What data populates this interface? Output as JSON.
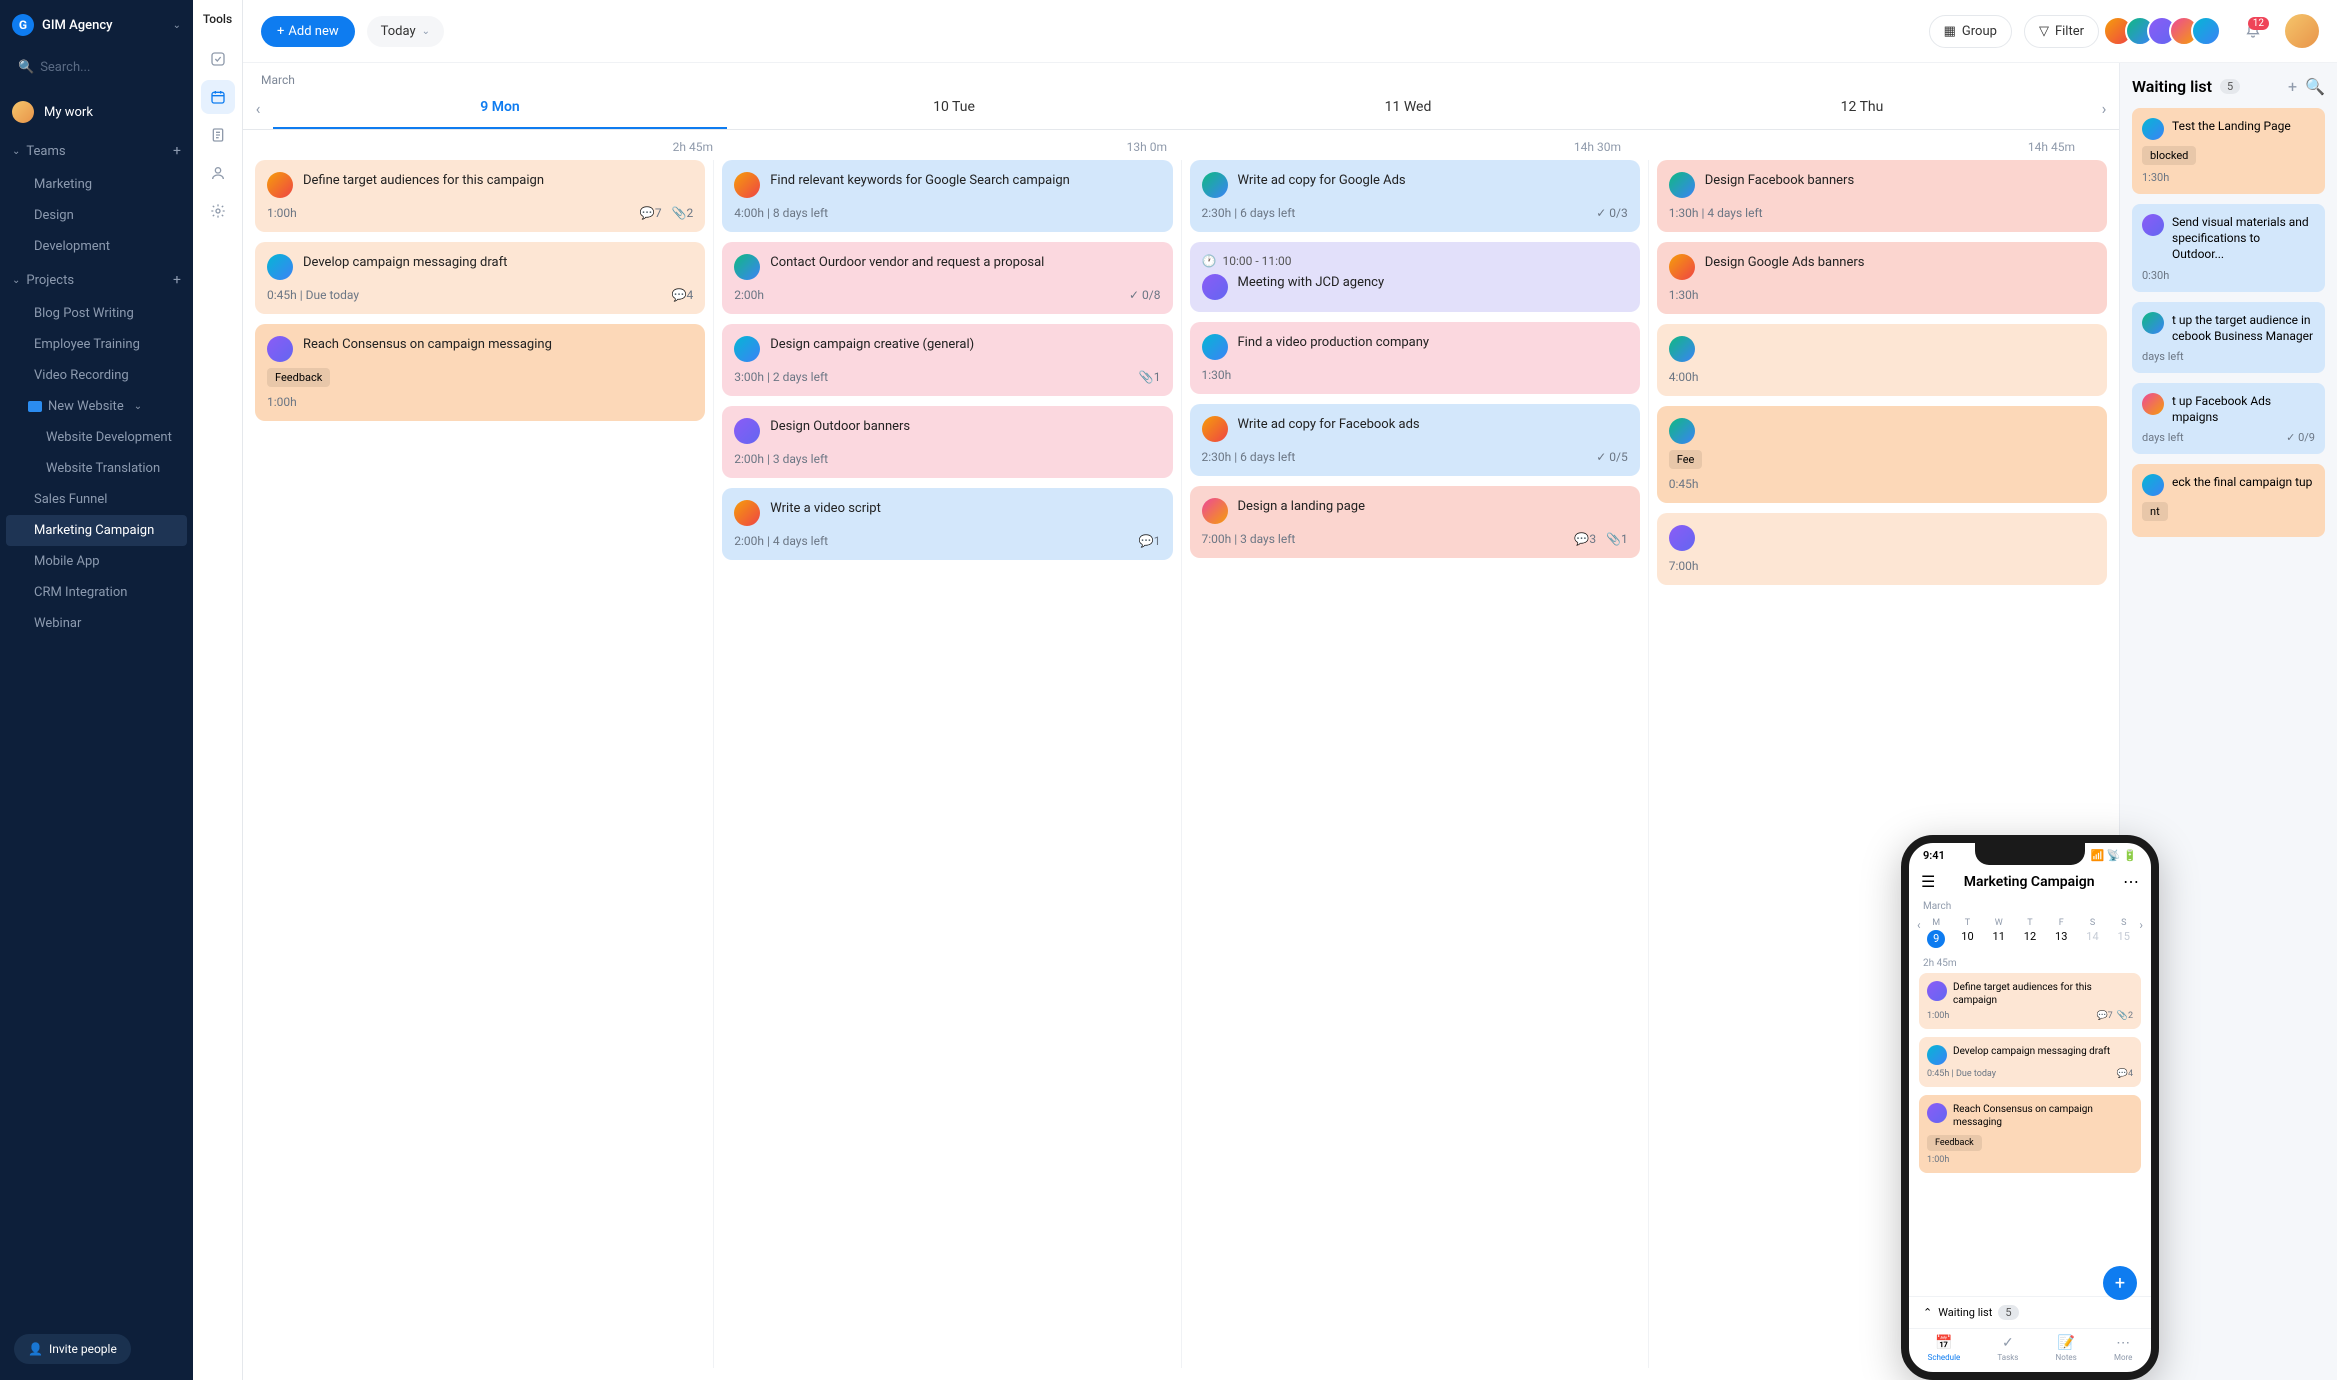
{
  "org": {
    "name": "GIM Agency",
    "letter": "G"
  },
  "search": {
    "placeholder": "Search..."
  },
  "mywork": "My work",
  "sections": {
    "teams": "Teams",
    "projects": "Projects"
  },
  "teams": [
    "Marketing",
    "Design",
    "Development"
  ],
  "projects": [
    "Blog Post Writing",
    "Employee Training",
    "Video Recording"
  ],
  "folder": {
    "name": "New Website",
    "items": [
      "Website Development",
      "Website Translation"
    ]
  },
  "projects2": [
    "Sales Funnel",
    "Marketing Campaign",
    "Mobile App",
    "CRM Integration",
    "Webinar"
  ],
  "activeProject": "Marketing Campaign",
  "invite": "Invite people",
  "toolRail": {
    "label": "Tools"
  },
  "topbar": {
    "addNew": "Add new",
    "today": "Today",
    "group": "Group",
    "filter": "Filter",
    "notificationCount": "12"
  },
  "calendar": {
    "month": "March",
    "days": [
      {
        "label": "9 Mon",
        "hours": "2h 45m"
      },
      {
        "label": "10 Tue",
        "hours": "13h 0m"
      },
      {
        "label": "11 Wed",
        "hours": "14h 30m"
      },
      {
        "label": "12 Thu",
        "hours": "14h 45m"
      }
    ]
  },
  "columns": [
    [
      {
        "c": "c-peach",
        "title": "Define target audiences for this campaign",
        "time": "1:00h",
        "comments": "7",
        "attach": "2"
      },
      {
        "c": "c-peach",
        "title": "Develop campaign messaging draft",
        "time": "0:45h",
        "due": "Due today",
        "comments": "4"
      },
      {
        "c": "c-orange",
        "title": "Reach Consensus on campaign messaging",
        "tag": "Feedback",
        "time": "1:00h"
      }
    ],
    [
      {
        "c": "c-blue",
        "title": "Find relevant keywords for Google Search campaign",
        "time": "4:00h",
        "due": "8 days left"
      },
      {
        "c": "c-pink",
        "title": "Contact Ourdoor vendor and request a proposal",
        "time": "2:00h",
        "check": "0/8"
      },
      {
        "c": "c-pink",
        "title": "Design campaign creative (general)",
        "time": "3:00h",
        "due": "2 days left",
        "attach": "1"
      },
      {
        "c": "c-pink",
        "title": "Design Outdoor banners",
        "time": "2:00h",
        "due": "3 days left"
      },
      {
        "c": "c-blue",
        "title": "Write a video script",
        "time": "2:00h",
        "due": "4 days left",
        "comments": "1"
      }
    ],
    [
      {
        "c": "c-blue",
        "title": "Write ad copy for Google Ads",
        "time": "2:30h",
        "due": "6 days left",
        "check": "0/3"
      },
      {
        "c": "c-lav",
        "clock": "10:00 - 11:00",
        "title": "Meeting with JCD agency"
      },
      {
        "c": "c-pink",
        "title": "Find a video production company",
        "time": "1:30h"
      },
      {
        "c": "c-blue",
        "title": "Write ad copy for Facebook ads",
        "time": "2:30h",
        "due": "6 days left",
        "check": "0/5"
      },
      {
        "c": "c-red",
        "title": "Design a landing page",
        "time": "7:00h",
        "due": "3 days left",
        "comments": "3",
        "attach": "1"
      }
    ],
    [
      {
        "c": "c-red",
        "title": "Design Facebook banners",
        "time": "1:30h",
        "due": "4 days left"
      },
      {
        "c": "c-red",
        "title": "Design Google Ads banners",
        "time": "1:30h"
      },
      {
        "c": "c-peach",
        "title": "",
        "time": "4:00h"
      },
      {
        "c": "c-orange",
        "title": "",
        "tag": "Fee",
        "time": "0:45h"
      },
      {
        "c": "c-peach",
        "title": "",
        "time": "7:00h"
      }
    ]
  ],
  "waiting": {
    "title": "Waiting list",
    "count": "5",
    "items": [
      {
        "c": "c-orange",
        "title": "Test the Landing Page",
        "tag": "blocked",
        "time": "1:30h"
      },
      {
        "c": "c-blue",
        "title": "Send visual materials and specifications to Outdoor...",
        "time": "0:30h"
      },
      {
        "c": "c-blue",
        "title": "t up the target audience in cebook Business Manager",
        "due": "days left"
      },
      {
        "c": "c-blue",
        "title": "t up Facebook Ads mpaigns",
        "due": "days left",
        "check": "0/9"
      },
      {
        "c": "c-orange",
        "title": "eck the final campaign tup",
        "tag": "nt"
      }
    ]
  },
  "phone": {
    "time": "9:41",
    "title": "Marketing Campaign",
    "month": "March",
    "week": [
      {
        "wd": "M",
        "dn": "9",
        "active": true
      },
      {
        "wd": "T",
        "dn": "10"
      },
      {
        "wd": "W",
        "dn": "11"
      },
      {
        "wd": "T",
        "dn": "12"
      },
      {
        "wd": "F",
        "dn": "13"
      },
      {
        "wd": "S",
        "dn": "14",
        "dim": true
      },
      {
        "wd": "S",
        "dn": "15",
        "dim": true
      }
    ],
    "hours": "2h 45m",
    "cards": [
      {
        "c": "c-peach",
        "title": "Define target audiences for this campaign",
        "time": "1:00h",
        "comments": "7",
        "attach": "2"
      },
      {
        "c": "c-peach",
        "title": "Develop campaign messaging draft",
        "time": "0:45h",
        "due": "Due today",
        "comments": "4"
      },
      {
        "c": "c-orange",
        "title": "Reach Consensus on campaign messaging",
        "tag": "Feedback",
        "time": "1:00h"
      }
    ],
    "wait": {
      "label": "Waiting list",
      "count": "5"
    },
    "tabs": [
      "Schedule",
      "Tasks",
      "Notes",
      "More"
    ]
  }
}
